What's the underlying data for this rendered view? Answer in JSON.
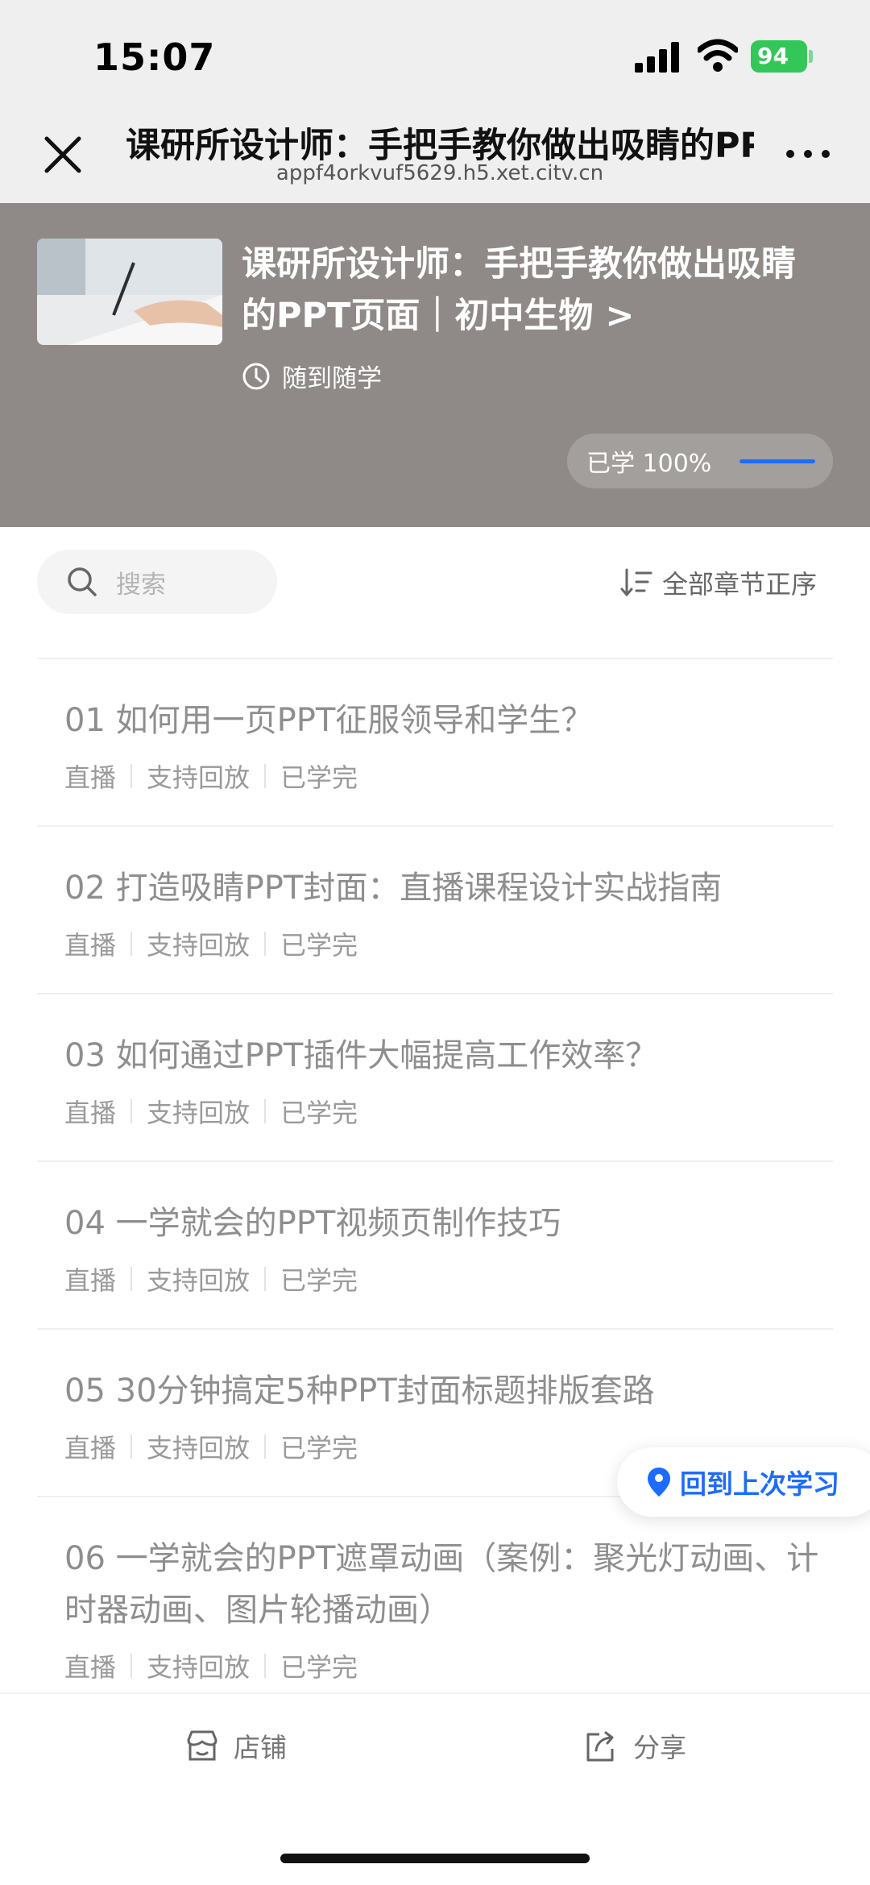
{
  "status_bar": {
    "time": "15:07",
    "battery": "94"
  },
  "nav": {
    "title": "课研所设计师：手把手教你做出吸睛的PPT页面｜初中生物",
    "subtitle": "appf4orkvuf5629.h5.xet.citv.cn",
    "close_icon": "close-icon",
    "more_icon": "more-icon"
  },
  "course": {
    "title": "课研所设计师：手把手教你做出吸睛的PPT页面｜初中生物 >",
    "mode": "随到随学",
    "progress_text": "已学 100%",
    "progress_value": 1.0
  },
  "search": {
    "placeholder": "搜索"
  },
  "sort": {
    "label": "全部章节正序"
  },
  "chapters": [
    {
      "title": "01 如何用一页PPT征服领导和学生？",
      "tags": [
        "直播",
        "支持回放",
        "已学完"
      ]
    },
    {
      "title": "02 打造吸睛PPT封面：直播课程设计实战指南",
      "tags": [
        "直播",
        "支持回放",
        "已学完"
      ]
    },
    {
      "title": "03 如何通过PPT插件大幅提高工作效率？",
      "tags": [
        "直播",
        "支持回放",
        "已学完"
      ]
    },
    {
      "title": "04 一学就会的PPT视频页制作技巧",
      "tags": [
        "直播",
        "支持回放",
        "已学完"
      ]
    },
    {
      "title": "05 30分钟搞定5种PPT封面标题排版套路",
      "tags": [
        "直播",
        "支持回放",
        "已学完"
      ]
    },
    {
      "title": "06 一学就会的PPT遮罩动画（案例：聚光灯动画、计时器动画、图片轮播动画）",
      "tags": [
        "直播",
        "支持回放",
        "已学完"
      ]
    }
  ],
  "resume_button": {
    "label": "回到上次学习"
  },
  "bottom_bar": {
    "shop_label": "店铺",
    "share_label": "分享"
  },
  "colors": {
    "accent": "#1e6bff",
    "hero_bg": "#8f8a88",
    "battery": "#33c759"
  }
}
